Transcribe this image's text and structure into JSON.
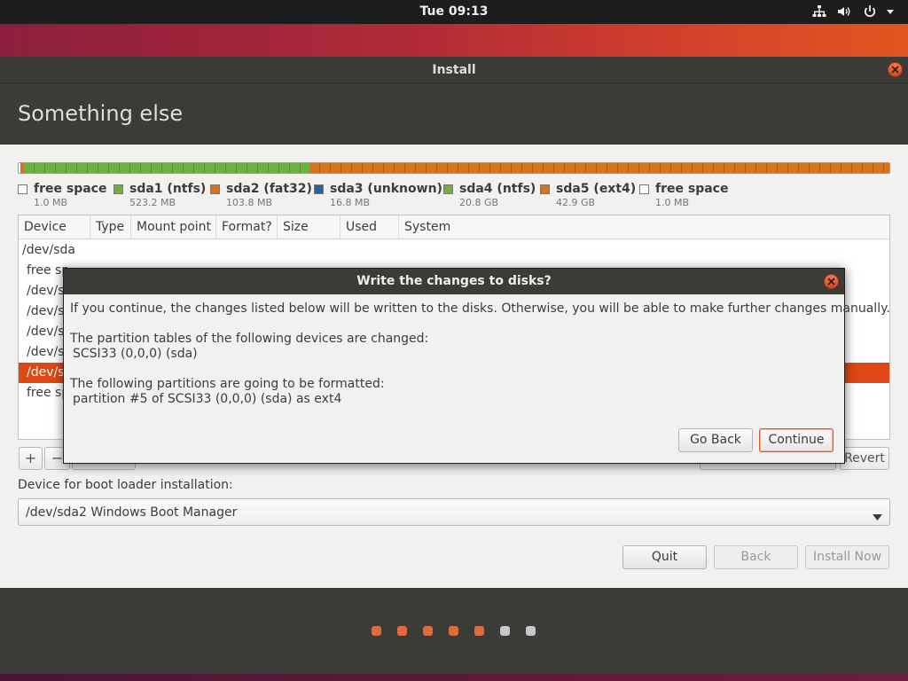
{
  "topbar": {
    "clock": "Tue 09:13",
    "icons": [
      "network-icon",
      "volume-icon",
      "power-icon",
      "dropdown-arrow-icon"
    ]
  },
  "window": {
    "title": "Install",
    "heading": "Something else"
  },
  "colors": {
    "accent": "#dd4814",
    "ntfs": "#6fb042",
    "fat32": "#d7731e",
    "unknown": "#2b5fa6",
    "ext4": "#d7731e",
    "free": "#ffffff"
  },
  "partition_legend": [
    {
      "name": "free space",
      "size": "1.0 MB",
      "color": "#ffffff"
    },
    {
      "name": "sda1 (ntfs)",
      "size": "523.2 MB",
      "color": "#6fb042"
    },
    {
      "name": "sda2 (fat32)",
      "size": "103.8 MB",
      "color": "#d7731e"
    },
    {
      "name": "sda3 (unknown)",
      "size": "16.8 MB",
      "color": "#2b5fa6"
    },
    {
      "name": "sda4 (ntfs)",
      "size": "20.8 GB",
      "color": "#6fb042"
    },
    {
      "name": "sda5 (ext4)",
      "size": "42.9 GB",
      "color": "#d7731e"
    },
    {
      "name": "free space",
      "size": "1.0 MB",
      "color": "#ffffff"
    }
  ],
  "table": {
    "columns": [
      "Device",
      "Type",
      "Mount point",
      "Format?",
      "Size",
      "Used",
      "System"
    ],
    "rows": [
      {
        "device": "/dev/sda",
        "selected": false
      },
      {
        "device": "free sp",
        "selected": false
      },
      {
        "device": "/dev/s",
        "selected": false
      },
      {
        "device": "/dev/s",
        "selected": false
      },
      {
        "device": "/dev/s",
        "selected": false
      },
      {
        "device": "/dev/s",
        "selected": false
      },
      {
        "device": "/dev/s",
        "selected": true
      },
      {
        "device": "free sp",
        "selected": false
      }
    ]
  },
  "table_controls": {
    "add_label": "+",
    "remove_label": "−",
    "revert_label": "Revert"
  },
  "bootloader": {
    "label": "Device for boot loader installation:",
    "value": "/dev/sda2 Windows Boot Manager"
  },
  "actions": {
    "quit": "Quit",
    "back": "Back",
    "install_now": "Install Now"
  },
  "progress": {
    "total_steps": 7,
    "completed_steps": 5
  },
  "dialog": {
    "title": "Write the changes to disks?",
    "intro": "If you continue, the changes listed below will be written to the disks. Otherwise, you will be able to make further changes manually.",
    "tables_heading": "The partition tables of the following devices are changed:",
    "tables_device": "SCSI33 (0,0,0) (sda)",
    "format_heading": "The following partitions are going to be formatted:",
    "format_item": "partition #5 of SCSI33 (0,0,0) (sda) as ext4",
    "go_back": "Go Back",
    "continue": "Continue"
  }
}
